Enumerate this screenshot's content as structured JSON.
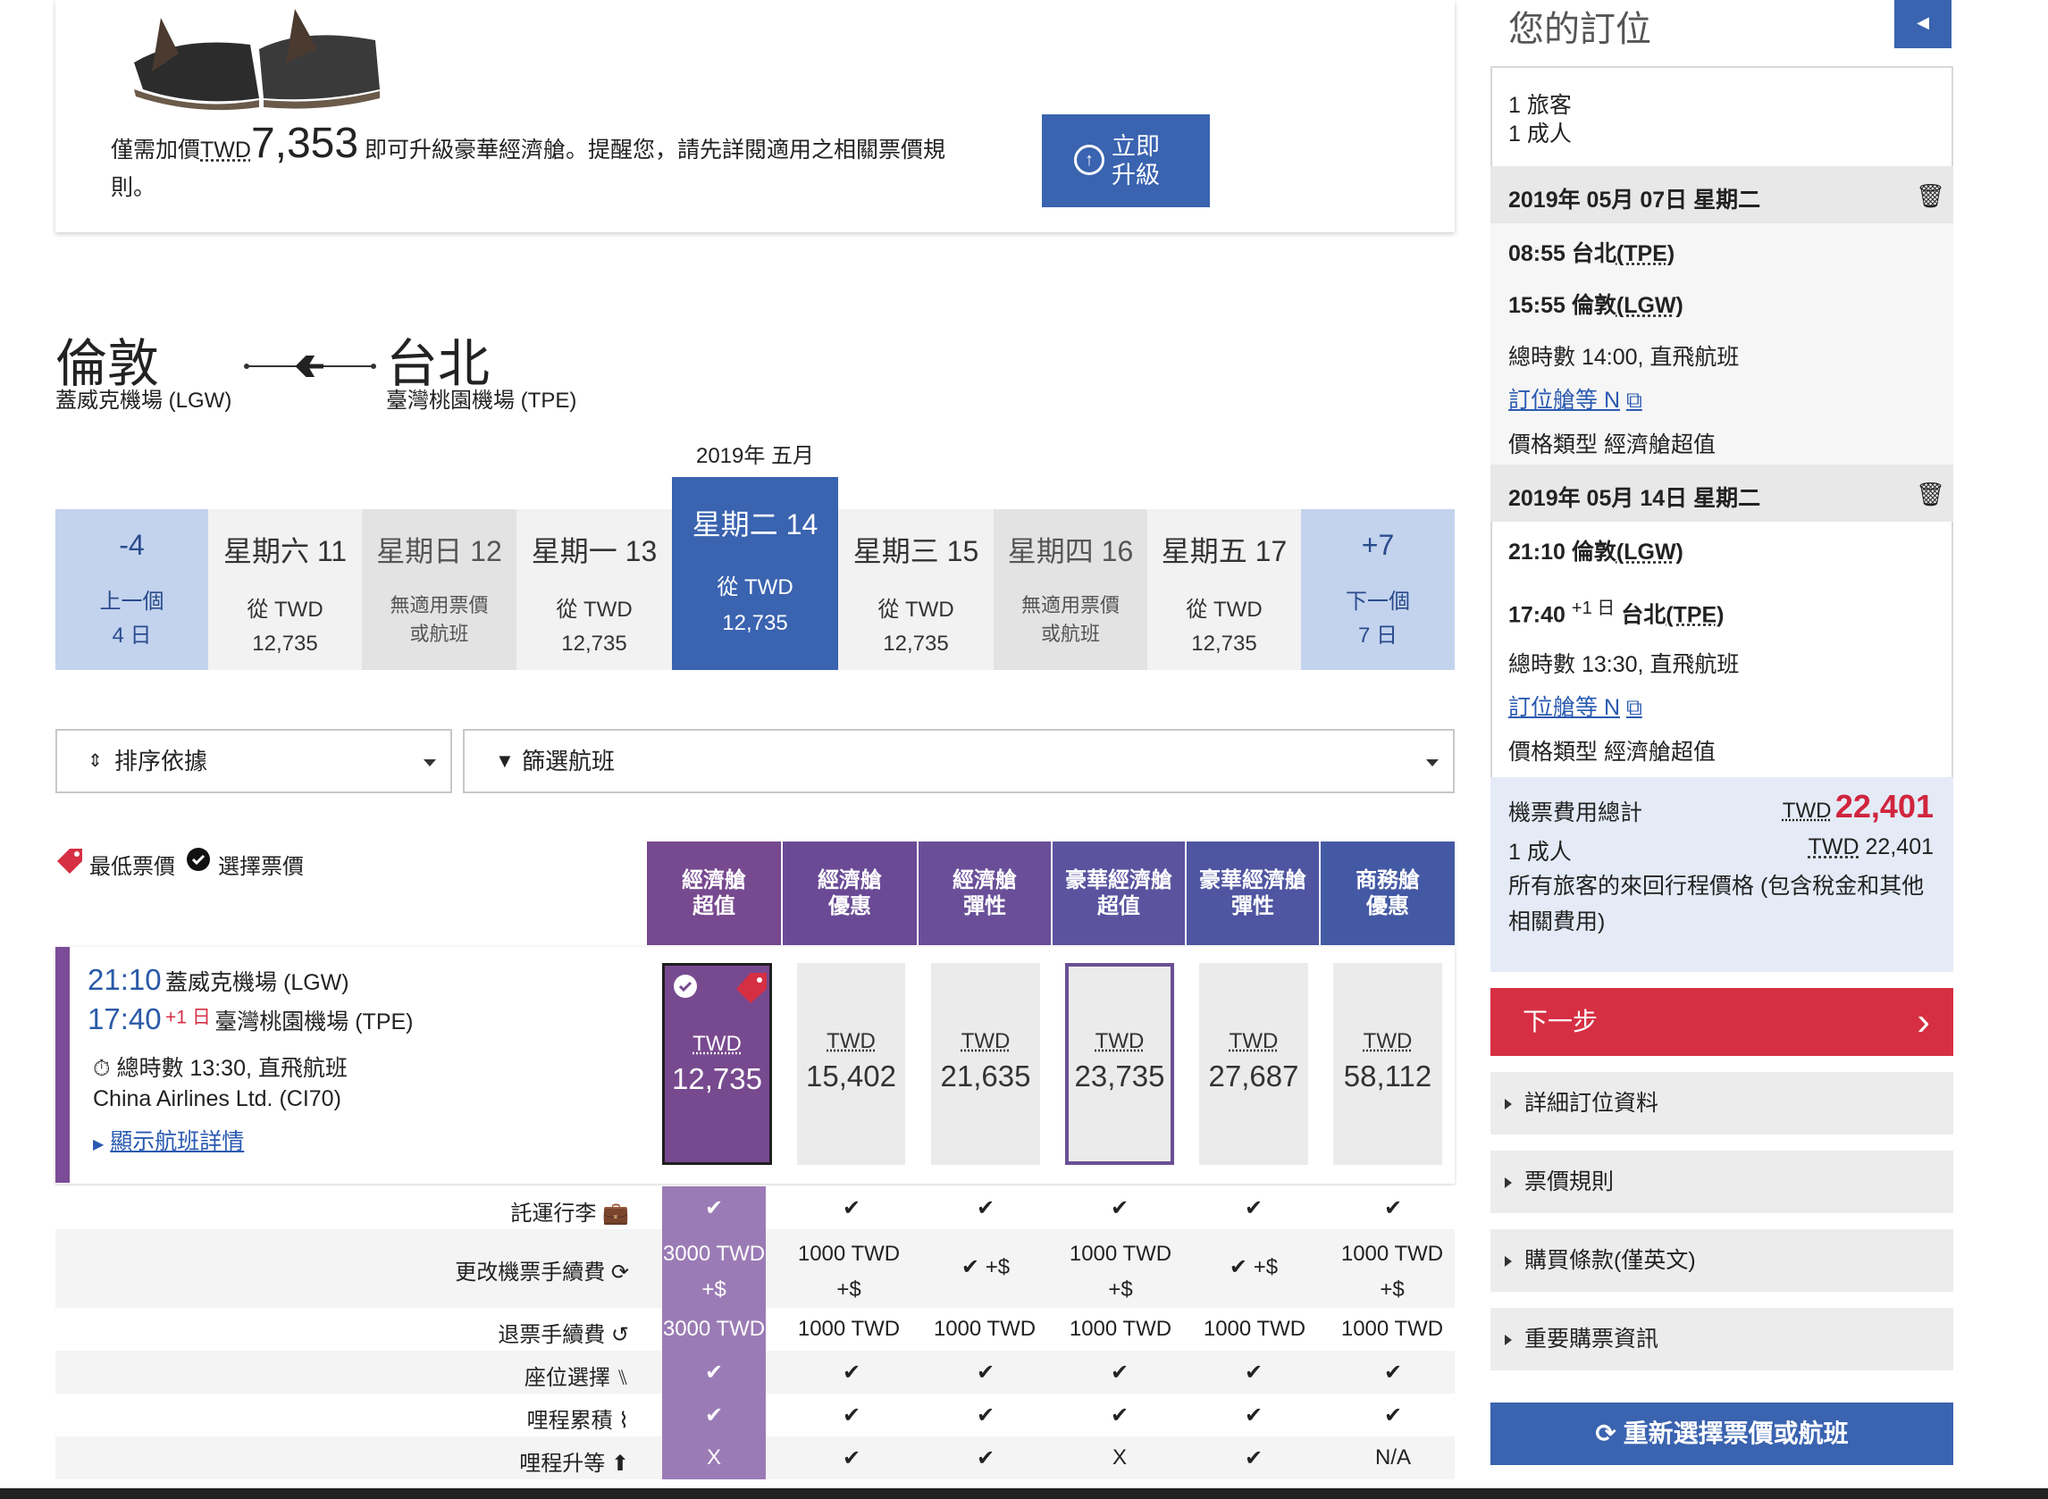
{
  "upgrade": {
    "prefix": "僅需加價",
    "currency": "TWD",
    "amount": "7,353",
    "suffix": "即可升級豪華經濟艙。提醒您，請先詳閱適用之相關票價規則。",
    "button_line1": "立即",
    "button_line2": "升級"
  },
  "route": {
    "from_city": "倫敦",
    "from_airport": "蓋威克機場 (LGW)",
    "to_city": "台北",
    "to_airport": "臺灣桃園機場 (TPE)"
  },
  "date_strip": {
    "month": "2019年 五月",
    "prev": {
      "label": "-4",
      "line1": "上一個",
      "line2": "4 日"
    },
    "next": {
      "label": "+7",
      "line1": "下一個",
      "line2": "7 日"
    },
    "days": [
      {
        "day": "星期六 11",
        "line1": "從 TWD",
        "line2": "12,735"
      },
      {
        "day": "星期日 12",
        "line1": "無適用票價",
        "line2": "或航班"
      },
      {
        "day": "星期一 13",
        "line1": "從 TWD",
        "line2": "12,735"
      },
      {
        "day": "星期二 14",
        "line1": "從 TWD",
        "line2": "12,735"
      },
      {
        "day": "星期三 15",
        "line1": "從 TWD",
        "line2": "12,735"
      },
      {
        "day": "星期四 16",
        "line1": "無適用票價",
        "line2": "或航班"
      },
      {
        "day": "星期五 17",
        "line1": "從 TWD",
        "line2": "12,735"
      }
    ]
  },
  "controls": {
    "sort": "排序依據",
    "filter": "篩選航班"
  },
  "legend": {
    "lowest": "最低票價",
    "selected": "選擇票價"
  },
  "fare_columns": [
    {
      "name": "經濟艙\n超值",
      "color": "#77498f"
    },
    {
      "name": "經濟艙\n優惠",
      "color": "#6b4a95"
    },
    {
      "name": "經濟艙\n彈性",
      "color": "#6a4f98"
    },
    {
      "name": "豪華經濟艙\n超值",
      "color": "#5b539e"
    },
    {
      "name": "豪華經濟艙\n彈性",
      "color": "#4f55a0"
    },
    {
      "name": "商務艙\n優惠",
      "color": "#4459a4"
    }
  ],
  "flight": {
    "dep_time": "21:10",
    "dep_airport": "蓋威克機場 (LGW)",
    "arr_time": "17:40",
    "arr_plus": "+1 日",
    "arr_airport": "臺灣桃園機場 (TPE)",
    "duration": "總時數 13:30, 直飛航班",
    "carrier": "China Airlines Ltd. (CI70)",
    "details_link": "顯示航班詳情",
    "fares": [
      {
        "currency": "TWD",
        "amount": "12,735"
      },
      {
        "currency": "TWD",
        "amount": "15,402"
      },
      {
        "currency": "TWD",
        "amount": "21,635"
      },
      {
        "currency": "TWD",
        "amount": "23,735"
      },
      {
        "currency": "TWD",
        "amount": "27,687"
      },
      {
        "currency": "TWD",
        "amount": "58,112"
      }
    ]
  },
  "benefits": [
    {
      "label": "託運行李",
      "icon": "luggage-icon",
      "values": [
        "✔",
        "✔",
        "✔",
        "✔",
        "✔",
        "✔"
      ]
    },
    {
      "label": "更改機票手續費",
      "icon": "refresh-icon",
      "values": [
        "3000 TWD\n+$",
        "1000 TWD\n+$",
        "✔ +$",
        "1000 TWD\n+$",
        "✔ +$",
        "1000 TWD\n+$"
      ]
    },
    {
      "label": "退票手續費",
      "icon": "refund-icon",
      "values": [
        "3000 TWD",
        "1000 TWD",
        "1000 TWD",
        "1000 TWD",
        "1000 TWD",
        "1000 TWD"
      ]
    },
    {
      "label": "座位選擇",
      "icon": "seat-icon",
      "values": [
        "✔",
        "✔",
        "✔",
        "✔",
        "✔",
        "✔"
      ]
    },
    {
      "label": "哩程累積",
      "icon": "mileage-icon",
      "values": [
        "✔",
        "✔",
        "✔",
        "✔",
        "✔",
        "✔"
      ]
    },
    {
      "label": "哩程升等",
      "icon": "upgrade-icon",
      "values": [
        "X",
        "✔",
        "✔",
        "X",
        "✔",
        "N/A"
      ]
    }
  ],
  "sidebar": {
    "title": "您的訂位",
    "passengers": "1 旅客",
    "adults": "1 成人",
    "seg1": {
      "date": "2019年 05月 07日 星期二",
      "dep_time": "08:55",
      "dep_city": "台北",
      "dep_code": "(TPE)",
      "arr_time": "15:55",
      "arr_city": "倫敦",
      "arr_code": "(LGW)",
      "duration": "總時數 14:00, 直飛航班",
      "class_link": "訂位艙等 N",
      "fare_type": "價格類型 經濟艙超值"
    },
    "seg2": {
      "date": "2019年 05月 14日 星期二",
      "dep_time": "21:10",
      "dep_city": "倫敦",
      "dep_code": "(LGW)",
      "arr_time": "17:40",
      "arr_plus": "+1 日",
      "arr_city": "台北",
      "arr_code": "(TPE)",
      "duration": "總時數 13:30, 直飛航班",
      "class_link": "訂位艙等 N",
      "fare_type": "價格類型 經濟艙超值"
    },
    "total_label": "機票費用總計",
    "total_currency": "TWD",
    "total_amount": "22,401",
    "adult_label": "1 成人",
    "adult_currency": "TWD",
    "adult_amount": "22,401",
    "note": "所有旅客的來回行程價格 (包含稅金和其他相關費用)",
    "next_button": "下一步",
    "accordions": [
      "詳細訂位資料",
      "票價規則",
      "購買條款(僅英文)",
      "重要購票資訊"
    ],
    "reselect": "重新選擇票價或航班"
  },
  "colors": {
    "brand_blue": "#3a63b0",
    "purple": "#77498f",
    "red": "#d62f43",
    "price_red": "#d0253e"
  }
}
